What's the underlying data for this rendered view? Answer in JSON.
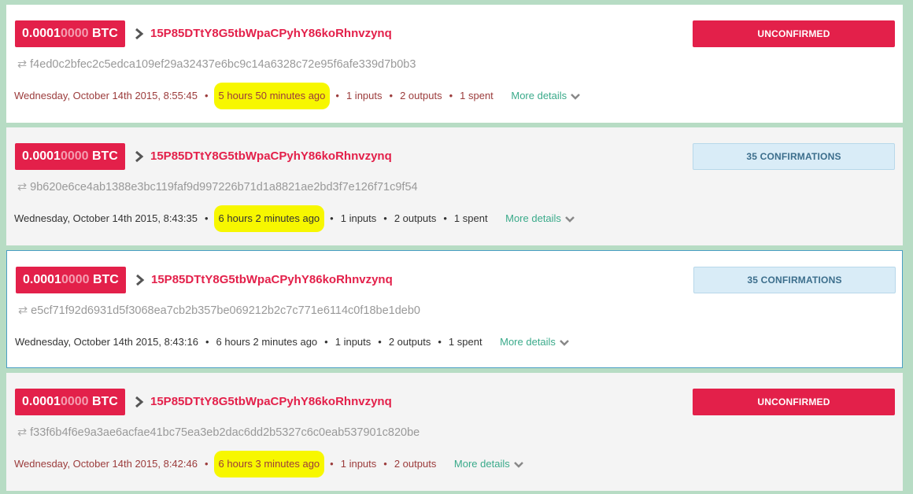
{
  "transactions": [
    {
      "amount_main": "0.0001",
      "amount_dim": "0000",
      "amount_unit": " BTC",
      "address": "15P85DTtY8G5tbWpaCPyhY86koRhnvzynq",
      "status": "UNCONFIRMED",
      "status_type": "unconfirmed",
      "hash": "f4ed0c2bfec2c5edca109ef29a32437e6bc9c14a6328c72e95f6afe339d7b0b3",
      "date": "Wednesday, October 14th 2015, 8:55:45",
      "ago": "5 hours 50 minutes ago",
      "highlighted": true,
      "inputs": "1 inputs",
      "outputs": "2 outputs",
      "spent": "1 spent",
      "more": "More details"
    },
    {
      "amount_main": "0.0001",
      "amount_dim": "0000",
      "amount_unit": " BTC",
      "address": "15P85DTtY8G5tbWpaCPyhY86koRhnvzynq",
      "status": "35 CONFIRMATIONS",
      "status_type": "confirmed",
      "hash": "9b620e6ce4ab1388e3bc119faf9d997226b71d1a8821ae2bd3f7e126f71c9f54",
      "date": "Wednesday, October 14th 2015, 8:43:35",
      "ago": "6 hours 2 minutes ago",
      "highlighted": true,
      "inputs": "1 inputs",
      "outputs": "2 outputs",
      "spent": "1 spent",
      "more": "More details"
    },
    {
      "amount_main": "0.0001",
      "amount_dim": "0000",
      "amount_unit": " BTC",
      "address": "15P85DTtY8G5tbWpaCPyhY86koRhnvzynq",
      "status": "35 CONFIRMATIONS",
      "status_type": "confirmed",
      "hash": "e5cf71f92d6931d5f3068ea7cb2b357be069212b2c7c771e6114c0f18be1deb0",
      "date": "Wednesday, October 14th 2015, 8:43:16",
      "ago": "6 hours 2 minutes ago",
      "highlighted": false,
      "inputs": "1 inputs",
      "outputs": "2 outputs",
      "spent": "1 spent",
      "more": "More details"
    },
    {
      "amount_main": "0.0001",
      "amount_dim": "0000",
      "amount_unit": " BTC",
      "address": "15P85DTtY8G5tbWpaCPyhY86koRhnvzynq",
      "status": "UNCONFIRMED",
      "status_type": "unconfirmed",
      "hash": "f33f6b4f6e9a3ae6acfae41bc75ea3eb2dac6dd2b5327c6c0eab537901c820be",
      "date": "Wednesday, October 14th 2015, 8:42:46",
      "ago": "6 hours 3 minutes ago",
      "highlighted": true,
      "inputs": "1 inputs",
      "outputs": "2 outputs",
      "spent": "",
      "more": "More details"
    }
  ],
  "icons": {
    "chevron": "chevron-right-icon",
    "swap": "swap-arrows-icon",
    "caret": "chevron-down-icon"
  },
  "colors": {
    "accent_red": "#e3204a",
    "link_green": "#3aaa8a",
    "confirm_bg": "#d9ecf7",
    "highlight": "#f7f700"
  }
}
